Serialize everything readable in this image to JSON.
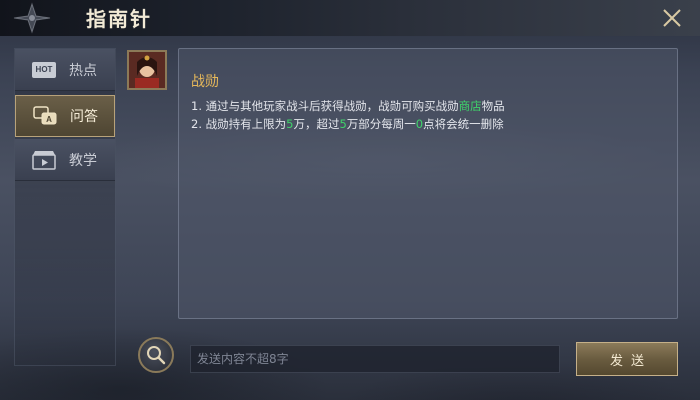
{
  "header": {
    "title": "指南针",
    "close_icon": "close-icon"
  },
  "sidebar": {
    "items": [
      {
        "label": "热点",
        "icon": "hot-icon",
        "badge": "HOT",
        "active": false
      },
      {
        "label": "问答",
        "icon": "qa-chat-icon",
        "active": true
      },
      {
        "label": "教学",
        "icon": "video-clapper-icon",
        "active": false
      }
    ]
  },
  "content": {
    "title": "战勋",
    "lines": [
      {
        "parts": [
          "1. 通过与其他玩家战斗后获得战勋，战勋可购买战勋",
          "商店",
          "物品"
        ]
      },
      {
        "parts": [
          "2. 战勋持有上限为",
          "5",
          "万，超过",
          "5",
          "万部分每周一",
          "0",
          "点将会统一删除"
        ]
      }
    ]
  },
  "footer": {
    "search_icon": "search-icon",
    "input_placeholder": "发送内容不超8字",
    "send_label": "发送"
  },
  "colors": {
    "accent_gold": "#e6b85a",
    "highlight_green": "#3fd36a",
    "active_tab": "#6a5f48"
  }
}
